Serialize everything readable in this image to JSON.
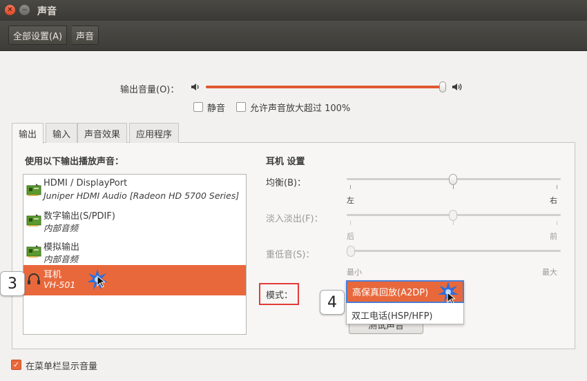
{
  "window": {
    "title": "声音"
  },
  "toolbar": {
    "all_settings": "全部设置(A)",
    "sound": "声音"
  },
  "output_volume": {
    "label": "输出音量(O)：",
    "level_percent": 100
  },
  "mute": {
    "label": "静音",
    "checked": false
  },
  "amplify": {
    "label": "允许声音放大超过 100%",
    "checked": false
  },
  "tabs": [
    {
      "label": "输出",
      "active": true
    },
    {
      "label": "输入",
      "active": false
    },
    {
      "label": "声音效果",
      "active": false
    },
    {
      "label": "应用程序",
      "active": false
    }
  ],
  "device_list": {
    "heading": "使用以下输出播放声音：",
    "devices": [
      {
        "name": "HDMI / DisplayPort",
        "sub": "Juniper HDMI Audio [Radeon HD 5700 Series]",
        "icon": "sound-card-icon",
        "selected": false
      },
      {
        "name": "数字输出(S/PDIF)",
        "sub": "内部音频",
        "icon": "sound-card-icon",
        "selected": false
      },
      {
        "name": "模拟输出",
        "sub": "内部音频",
        "icon": "sound-card-icon",
        "selected": false
      },
      {
        "name": "耳机",
        "sub": "VH-501",
        "icon": "headphones-icon",
        "selected": true
      }
    ]
  },
  "settings": {
    "heading": "耳机 设置",
    "balance": {
      "label": "均衡(B)：",
      "left": "左",
      "right": "右",
      "value": 0.5
    },
    "fade": {
      "label": "淡入淡出(F)：",
      "left": "后",
      "right": "前",
      "value": 0.5
    },
    "subwoofer": {
      "label": "重低音(S)：",
      "left": "最小",
      "right": "最大",
      "value": 0.0
    },
    "mode": {
      "label": "模式：",
      "options": [
        "高保真回放(A2DP)",
        "双工电话(HSP/HFP)"
      ],
      "selected": "高保真回放(A2DP)"
    },
    "test_button": "测试声音"
  },
  "annotations": {
    "step_a": "3",
    "step_b": "4"
  },
  "show_in_menubar": {
    "label": "在菜单栏显示音量",
    "checked": true
  },
  "colors": {
    "accent": "#e8683b",
    "highlight_border": "#4a7fd6",
    "annotation_border": "#e33a36"
  }
}
